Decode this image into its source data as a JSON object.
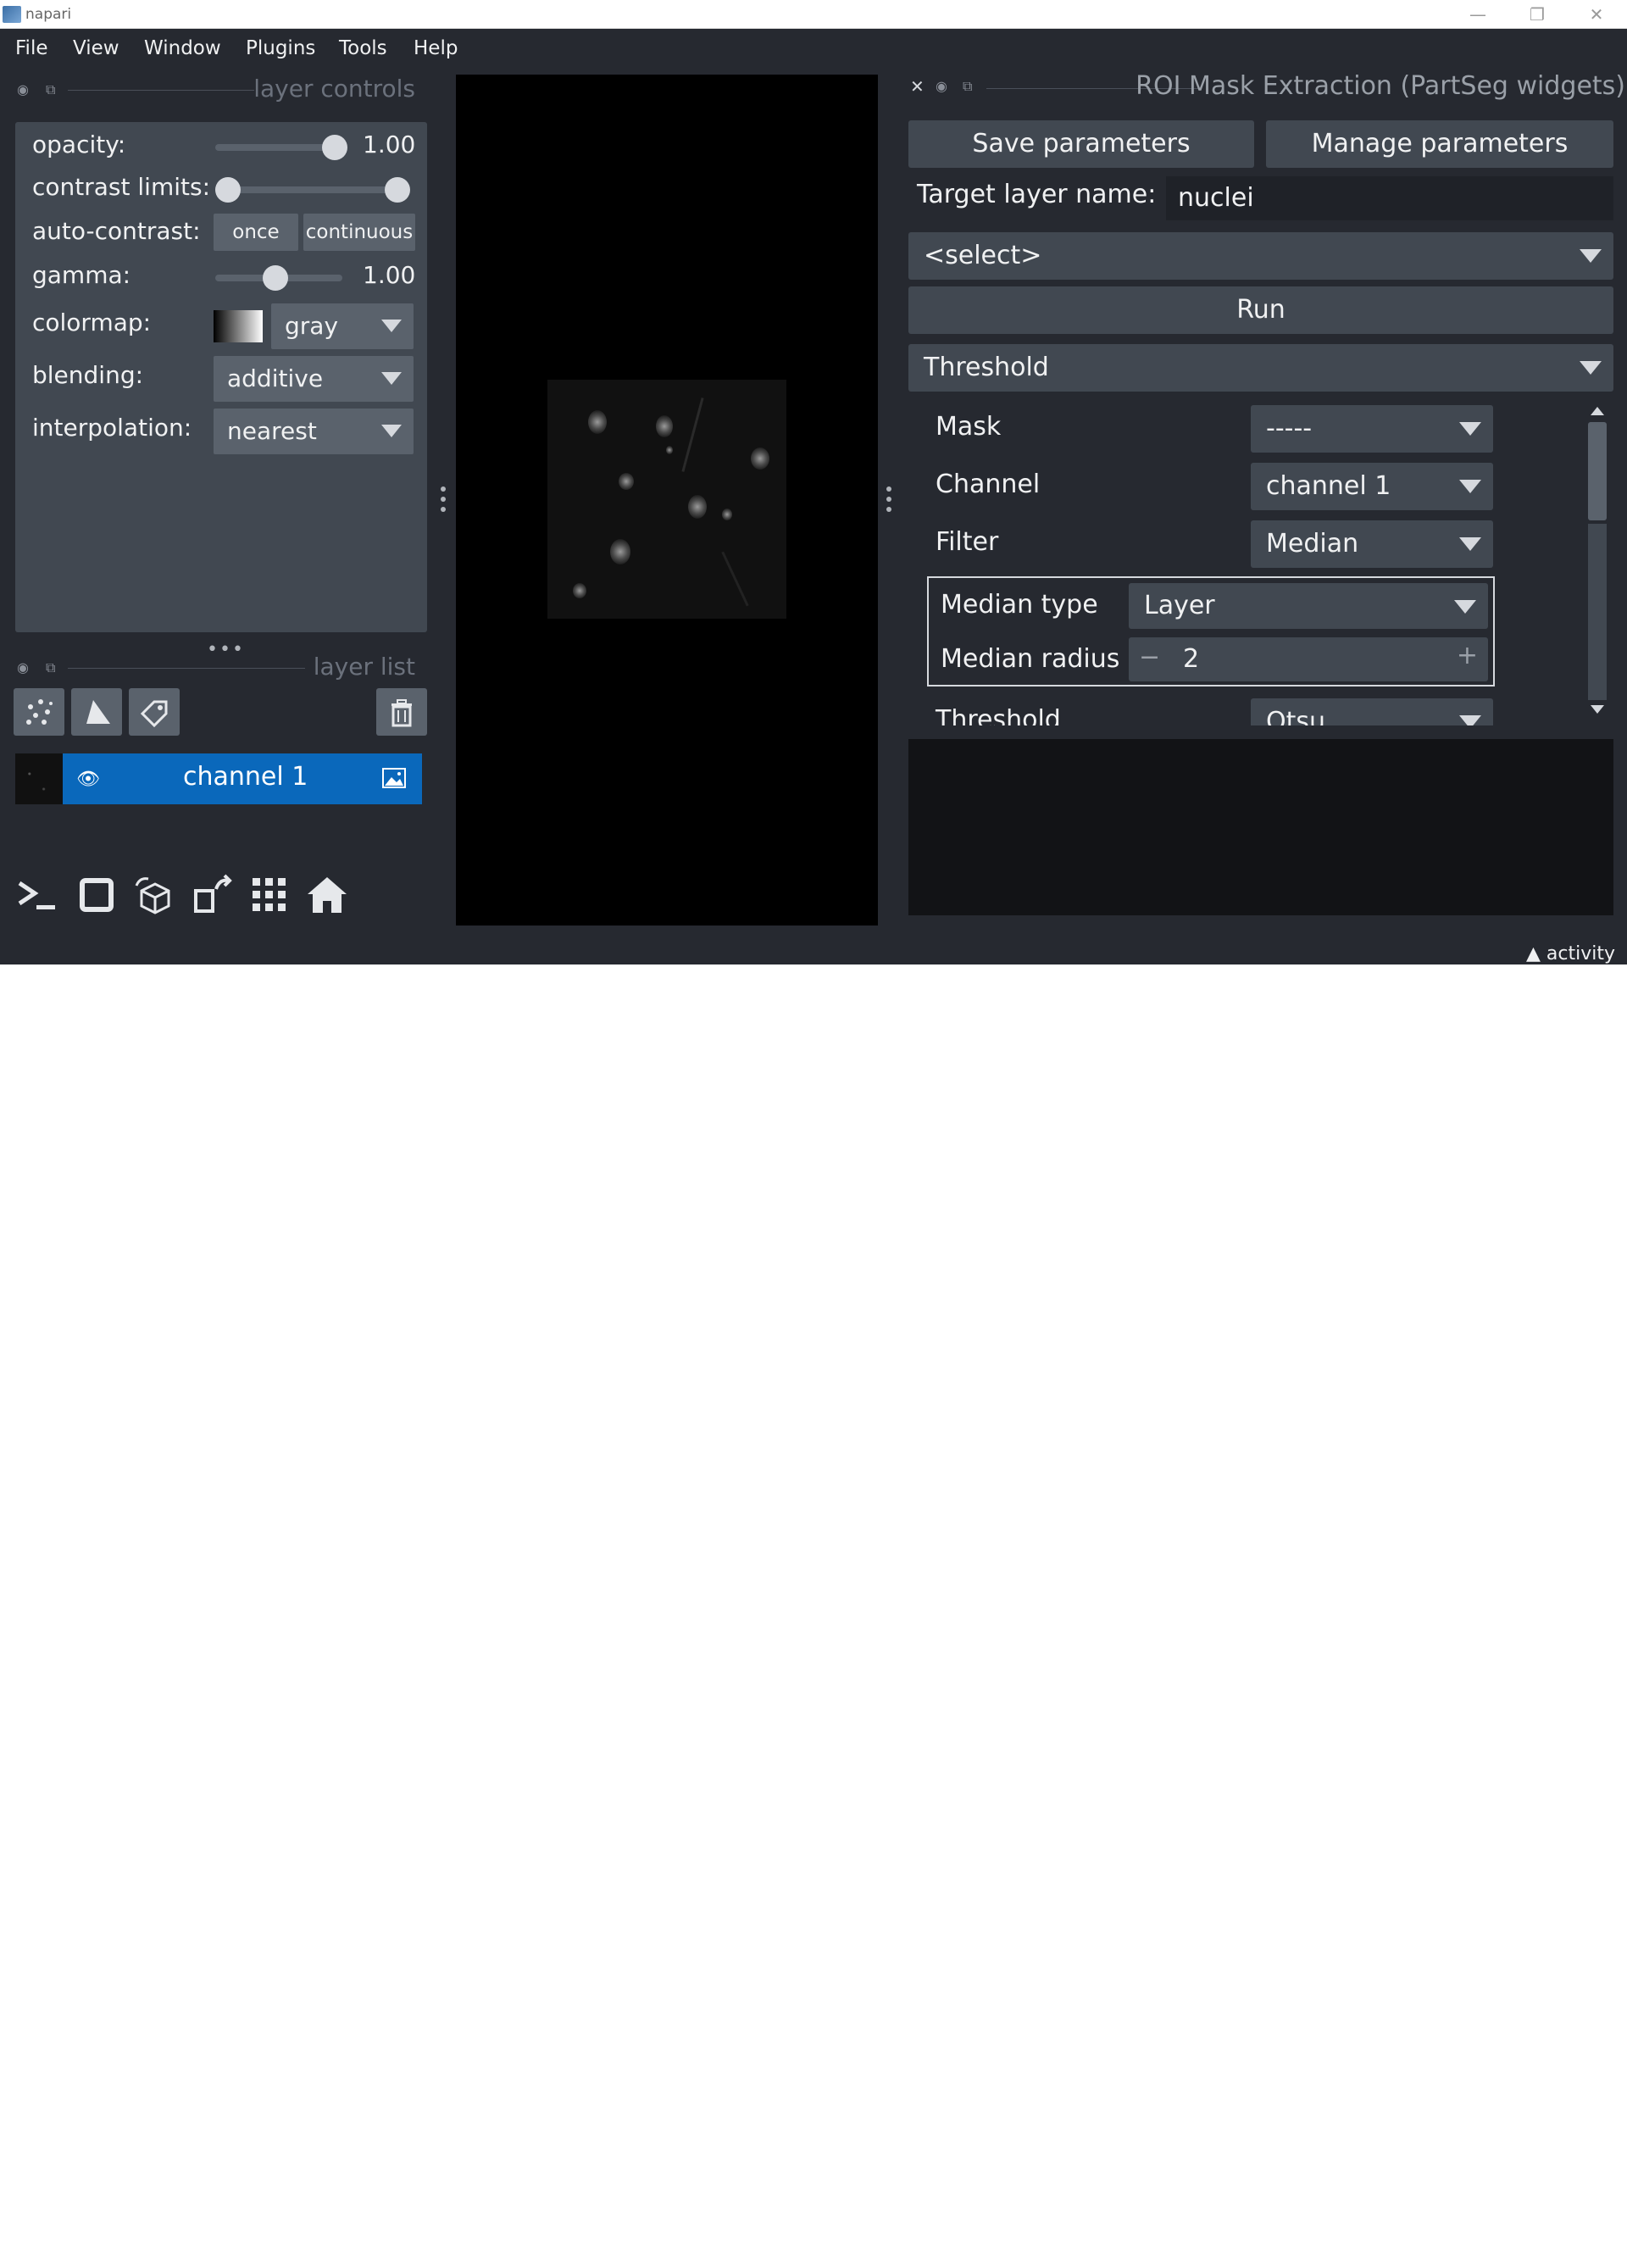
{
  "window": {
    "title": "napari",
    "min_icon": "minimize-icon",
    "max_icon": "restore-icon",
    "close_icon": "close-icon"
  },
  "menu": [
    "File",
    "View",
    "Window",
    "Plugins",
    "Tools",
    "Help"
  ],
  "layer_controls": {
    "title": "layer controls",
    "opacity_label": "opacity:",
    "opacity_value": "1.00",
    "opacity_level": 1.0,
    "contrast_label": "contrast limits:",
    "auto_contrast_label": "auto-contrast:",
    "once_label": "once",
    "continuous_label": "continuous",
    "gamma_label": "gamma:",
    "gamma_value": "1.00",
    "colormap_label": "colormap:",
    "colormap_value": "gray",
    "blending_label": "blending:",
    "blending_value": "additive",
    "interpolation_label": "interpolation:",
    "interpolation_value": "nearest"
  },
  "layer_list": {
    "title": "layer list",
    "layers": [
      {
        "name": "channel 1",
        "visible": true
      }
    ],
    "selected_color": "#0a68bb"
  },
  "roi_widget": {
    "title": "ROI Mask Extraction (PartSeg widgets)",
    "save_label": "Save parameters",
    "manage_label": "Manage parameters",
    "target_label": "Target layer name:",
    "target_value": "nuclei",
    "select_value": "<select>",
    "run_label": "Run",
    "algorithm_value": "Threshold",
    "mask_label": "Mask",
    "mask_value": "-----",
    "channel_label": "Channel",
    "channel_value": "channel 1",
    "filter_label": "Filter",
    "filter_value": "Median",
    "median_type_label": "Median type",
    "median_type_value": "Layer",
    "median_radius_label": "Median radius",
    "median_radius_value": "2",
    "threshold_label": "Threshold",
    "threshold_value": "Otsu"
  },
  "status": {
    "activity_label": "activity"
  },
  "colors": {
    "background": "#262930",
    "panel": "#414851",
    "control": "#5a626c",
    "accent": "#0a68bb"
  }
}
